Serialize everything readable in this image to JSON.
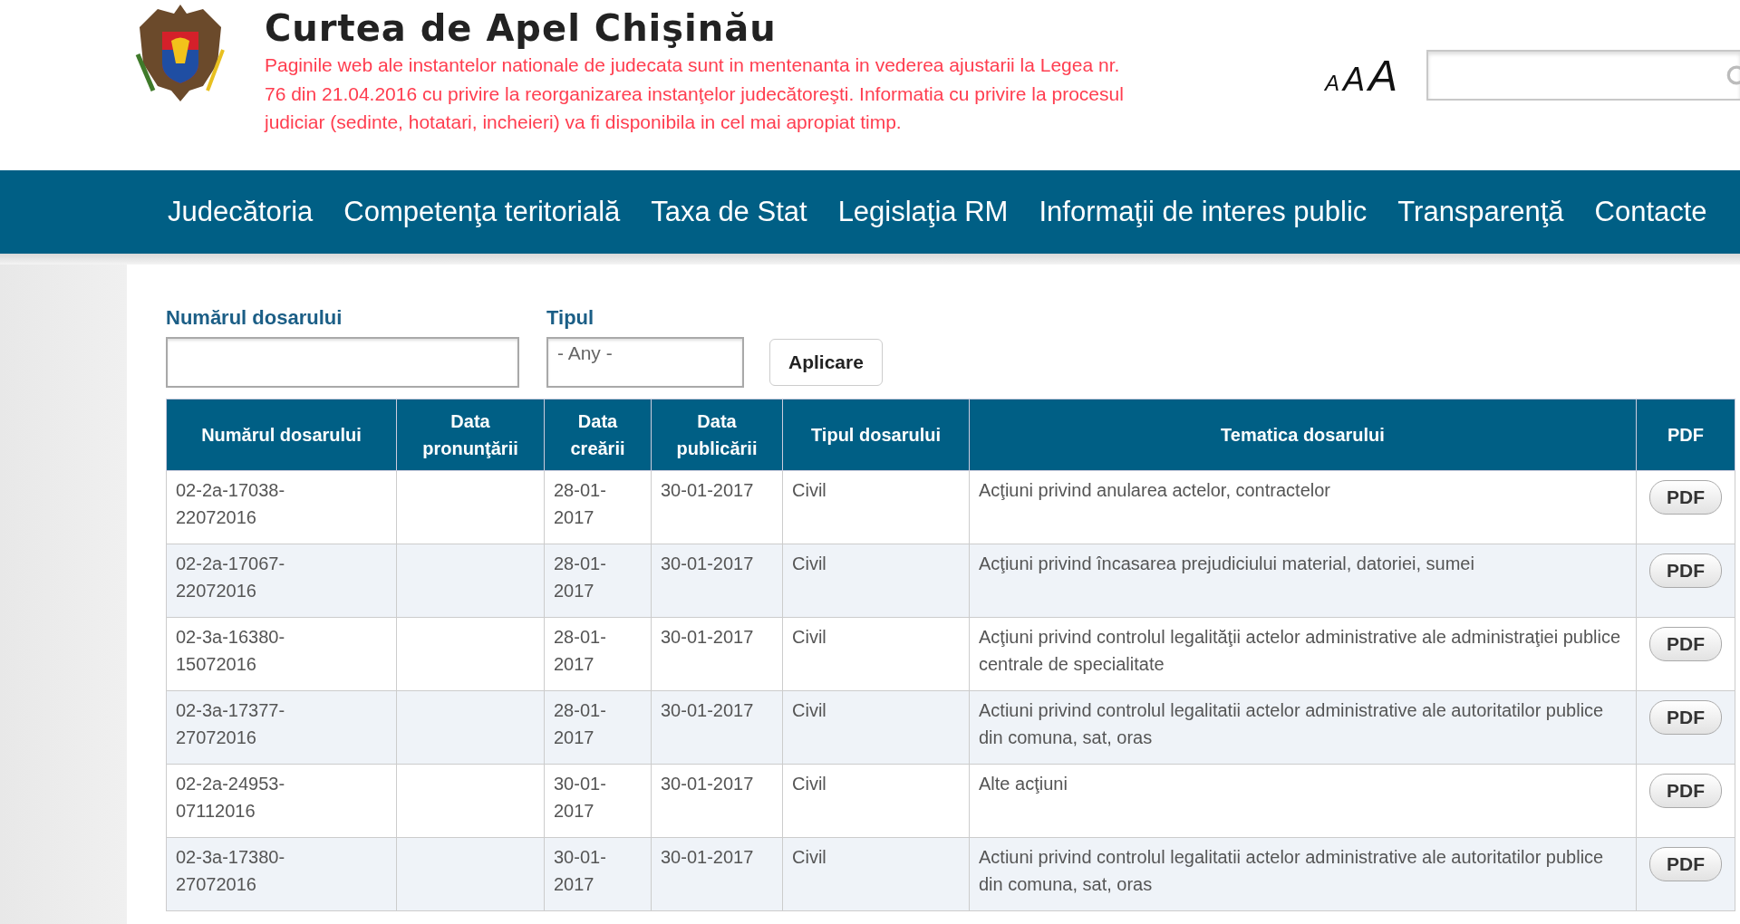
{
  "header": {
    "title": "Curtea de Apel Chişinău",
    "notice": "Paginile web ale instantelor nationale de judecata sunt in mentenanta in vederea ajustarii la Legea nr. 76 din 21.04.2016 cu privire la reorganizarea instanţelor judecătoreşti. Informatia cu privire la procesul judiciar (sedinte, hotatari, incheieri) va fi disponibila in cel mai apropiat timp.",
    "font_sizes": [
      "A",
      "A",
      "A"
    ]
  },
  "nav": [
    "Judecătoria",
    "Competenţa teritorială",
    "Taxa de Stat",
    "Legislaţia RM",
    "Informaţii de interes public",
    "Transparenţă",
    "Contacte"
  ],
  "filters": {
    "case_number": {
      "label": "Numărul dosarului"
    },
    "type": {
      "label": "Tipul",
      "value": "- Any -"
    },
    "apply": "Aplicare"
  },
  "table": {
    "columns": [
      "Numărul dosarului",
      "Data pronunţării",
      "Data creării",
      "Data publicării",
      "Tipul dosarului",
      "Tematica dosarului",
      "PDF"
    ],
    "rows": [
      {
        "number": "02-2a-17038-22072016",
        "pronounced": "",
        "created": "28-01-2017",
        "published": "30-01-2017",
        "type": "Civil",
        "topic": "Acţiuni privind anularea actelor, contractelor",
        "pdf": "PDF"
      },
      {
        "number": "02-2a-17067-22072016",
        "pronounced": "",
        "created": "28-01-2017",
        "published": "30-01-2017",
        "type": "Civil",
        "topic": "Acţiuni privind încasarea prejudiciului material, datoriei, sumei",
        "pdf": "PDF"
      },
      {
        "number": "02-3a-16380-15072016",
        "pronounced": "",
        "created": "28-01-2017",
        "published": "30-01-2017",
        "type": "Civil",
        "topic": "Acţiuni privind controlul legalităţii actelor administrative ale administraţiei publice centrale de specialitate",
        "pdf": "PDF"
      },
      {
        "number": "02-3a-17377-27072016",
        "pronounced": "",
        "created": "28-01-2017",
        "published": "30-01-2017",
        "type": "Civil",
        "topic": "Actiuni privind controlul legalitatii actelor administrative ale autoritatilor publice din comuna, sat, oras",
        "pdf": "PDF"
      },
      {
        "number": "02-2a-24953-07112016",
        "pronounced": "",
        "created": "30-01-2017",
        "published": "30-01-2017",
        "type": "Civil",
        "topic": "Alte acţiuni",
        "pdf": "PDF"
      },
      {
        "number": "02-3a-17380-27072016",
        "pronounced": "",
        "created": "30-01-2017",
        "published": "30-01-2017",
        "type": "Civil",
        "topic": "Actiuni privind controlul legalitatii actelor administrative ale autoritatilor publice din comuna, sat, oras",
        "pdf": "PDF"
      }
    ]
  }
}
